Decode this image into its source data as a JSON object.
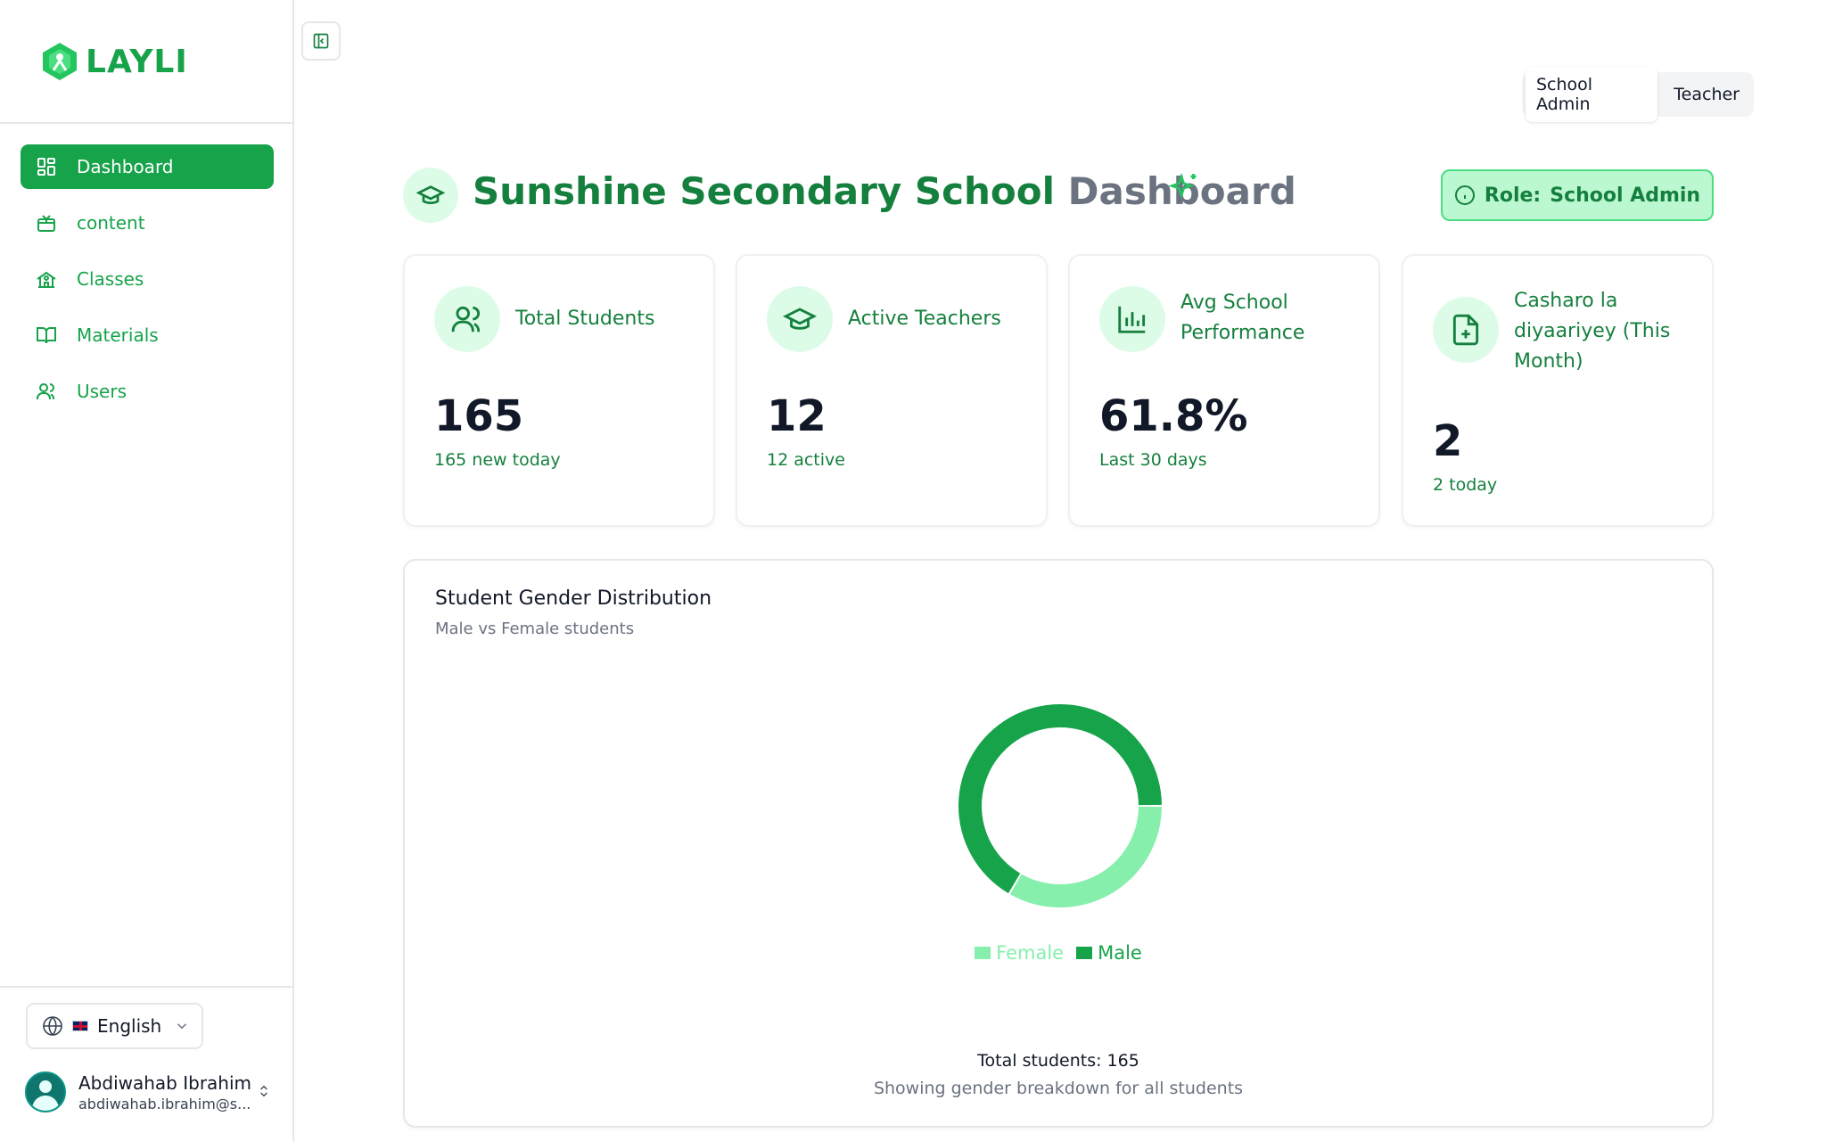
{
  "brand": {
    "name": "LAYLI",
    "accent": "#16a34a"
  },
  "sidebar": {
    "items": [
      {
        "label": "Dashboard",
        "icon": "dashboard-grid-icon",
        "active": true
      },
      {
        "label": "content",
        "icon": "content-box-icon",
        "active": false
      },
      {
        "label": "Classes",
        "icon": "school-building-icon",
        "active": false
      },
      {
        "label": "Materials",
        "icon": "book-open-icon",
        "active": false
      },
      {
        "label": "Users",
        "icon": "users-icon",
        "active": false
      }
    ],
    "language": {
      "label": "English",
      "icon": "globe-icon",
      "flag": "uk-flag-icon"
    },
    "user": {
      "name": "Abdiwahab Ibrahim",
      "email": "abdiwahab.ibrahim@s..."
    }
  },
  "topbar": {
    "role_switch": {
      "options": [
        "School Admin",
        "Teacher"
      ],
      "selected": "School Admin"
    }
  },
  "header": {
    "school": "Sunshine Secondary School",
    "suffix": "Dashboard",
    "role_prefix": "Role:",
    "role_value": "School Admin"
  },
  "stats": [
    {
      "label": "Total Students",
      "value": "165",
      "sub": "165 new today",
      "icon": "users-icon"
    },
    {
      "label": "Active Teachers",
      "value": "12",
      "sub": "12 active",
      "icon": "graduation-cap-icon"
    },
    {
      "label": "Avg School Performance",
      "value": "61.8%",
      "sub": "Last 30 days",
      "icon": "bar-chart-icon"
    },
    {
      "label": "Casharo la diyaariyey (This Month)",
      "value": "2",
      "sub": "2 today",
      "icon": "file-plus-icon"
    }
  ],
  "chart_section": {
    "title": "Student Gender Distribution",
    "subtitle": "Male vs Female students",
    "total": "Total students: 165",
    "note": "Showing gender breakdown for all students"
  },
  "chart_data": {
    "type": "pie",
    "donut": true,
    "categories": [
      "Female",
      "Male"
    ],
    "values": [
      55,
      110
    ],
    "colors": {
      "Female": "#86efac",
      "Male": "#16a34a"
    },
    "legend": "bottom"
  }
}
